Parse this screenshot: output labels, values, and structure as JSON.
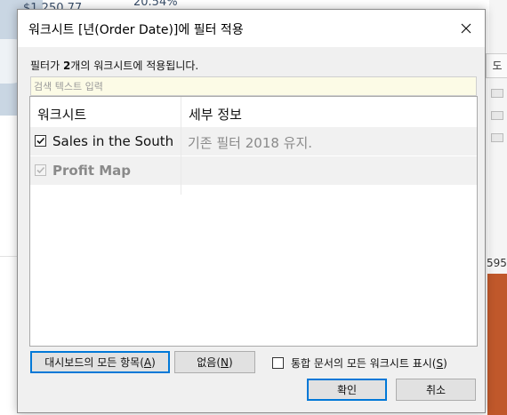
{
  "background": {
    "map_value_1": "$1,250.77",
    "map_value_2": "20.54%",
    "right_tab_label": "도",
    "right_number": "595"
  },
  "dialog": {
    "title": "워크시트 [년(Order Date)]에 필터 적용",
    "subtitle_prefix": "필터가 ",
    "subtitle_count": "2",
    "subtitle_suffix": "개의 워크시트에 적용됩니다.",
    "search": {
      "placeholder": "검색 텍스트 입력",
      "value": ""
    },
    "table": {
      "headers": [
        "워크시트",
        "세부 정보"
      ],
      "rows": [
        {
          "name": "Sales in the South",
          "checked": true,
          "enabled": true,
          "detail": "기존 필터 2018 유지."
        },
        {
          "name": "Profit Map",
          "checked": true,
          "enabled": false,
          "detail": ""
        }
      ]
    },
    "buttons": {
      "all_dashboard_label": "대시보드의 모든 항목",
      "all_dashboard_key": "A",
      "none_label": "없음",
      "none_key": "N",
      "ok": "확인",
      "cancel": "취소"
    },
    "show_all": {
      "label": "통합 문서의 모든 워크시트 표시",
      "key": "S",
      "checked": false
    }
  },
  "colors": {
    "accent": "#0078d7",
    "dialog_bg": "#f0f0f0",
    "search_bg": "#fcfbe6",
    "chart_bar": "#c0582b"
  }
}
